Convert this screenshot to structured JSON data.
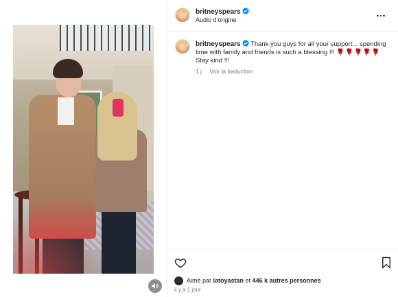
{
  "post": {
    "author": "britneyspears",
    "audio_label": "Audio d’origine",
    "caption": {
      "username": "britneyspears",
      "text": "Thank you guys for all your support... spending time with family and friends is such a blessing !!!",
      "emojis": "🌹🌹🌹🌹🌹",
      "tail": "Stay kind !!!",
      "age": "1 j",
      "translate_label": "Voir la traduction"
    },
    "likes": {
      "prefix": "Aimé par",
      "liker": "latoyastan",
      "connector": "et",
      "others": "446 k autres personnes"
    },
    "timestamp": "il y a 1 jour"
  },
  "icons": {
    "verified": "verified-badge-icon",
    "more": "more-options-icon",
    "like": "heart-icon",
    "save": "bookmark-icon",
    "audio": "speaker-icon"
  },
  "colors": {
    "verified_blue": "#0095f6",
    "text": "#262626",
    "muted": "#737373"
  }
}
